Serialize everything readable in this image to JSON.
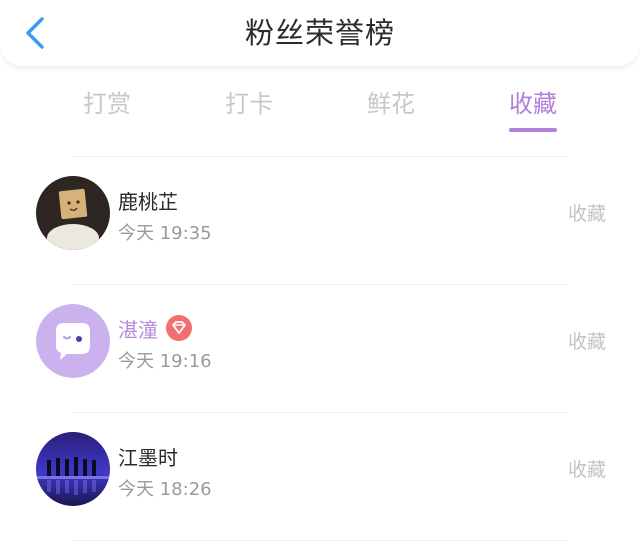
{
  "header": {
    "title": "粉丝荣誉榜"
  },
  "tabs": [
    {
      "label": "打赏",
      "active": false
    },
    {
      "label": "打卡",
      "active": false
    },
    {
      "label": "鲜花",
      "active": false
    },
    {
      "label": "收藏",
      "active": true
    }
  ],
  "colors": {
    "accent": "#b27fd9",
    "vip_name": "#b88be0",
    "vip_badge": "#f26f6f"
  },
  "rows": [
    {
      "name": "鹿桃芷",
      "time": "今天 19:35",
      "action": "收藏",
      "vip": false,
      "avatar_icon": "box-head-plush-avatar"
    },
    {
      "name": "湛潼",
      "time": "今天 19:16",
      "action": "收藏",
      "vip": true,
      "avatar_icon": "chat-bubble-avatar"
    },
    {
      "name": "江墨时",
      "time": "今天 18:26",
      "action": "收藏",
      "vip": false,
      "avatar_icon": "concert-stage-avatar"
    }
  ]
}
